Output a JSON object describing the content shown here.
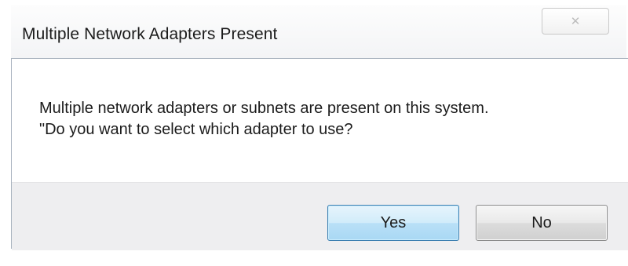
{
  "dialog": {
    "title": "Multiple Network Adapters Present",
    "close_icon": "close-icon",
    "message": {
      "line1": "Multiple network adapters or subnets are present on this system.",
      "line2": "\"Do you want to select which adapter to use?"
    },
    "buttons": {
      "yes_label": "Yes",
      "no_label": "No"
    }
  },
  "colors": {
    "title_bar": "#f3f4f6",
    "button_area": "#eeeef0",
    "default_button_border": "#3c7fb1",
    "default_button_fill": "#b9e0f7",
    "frame_border": "#a9b3bf"
  }
}
